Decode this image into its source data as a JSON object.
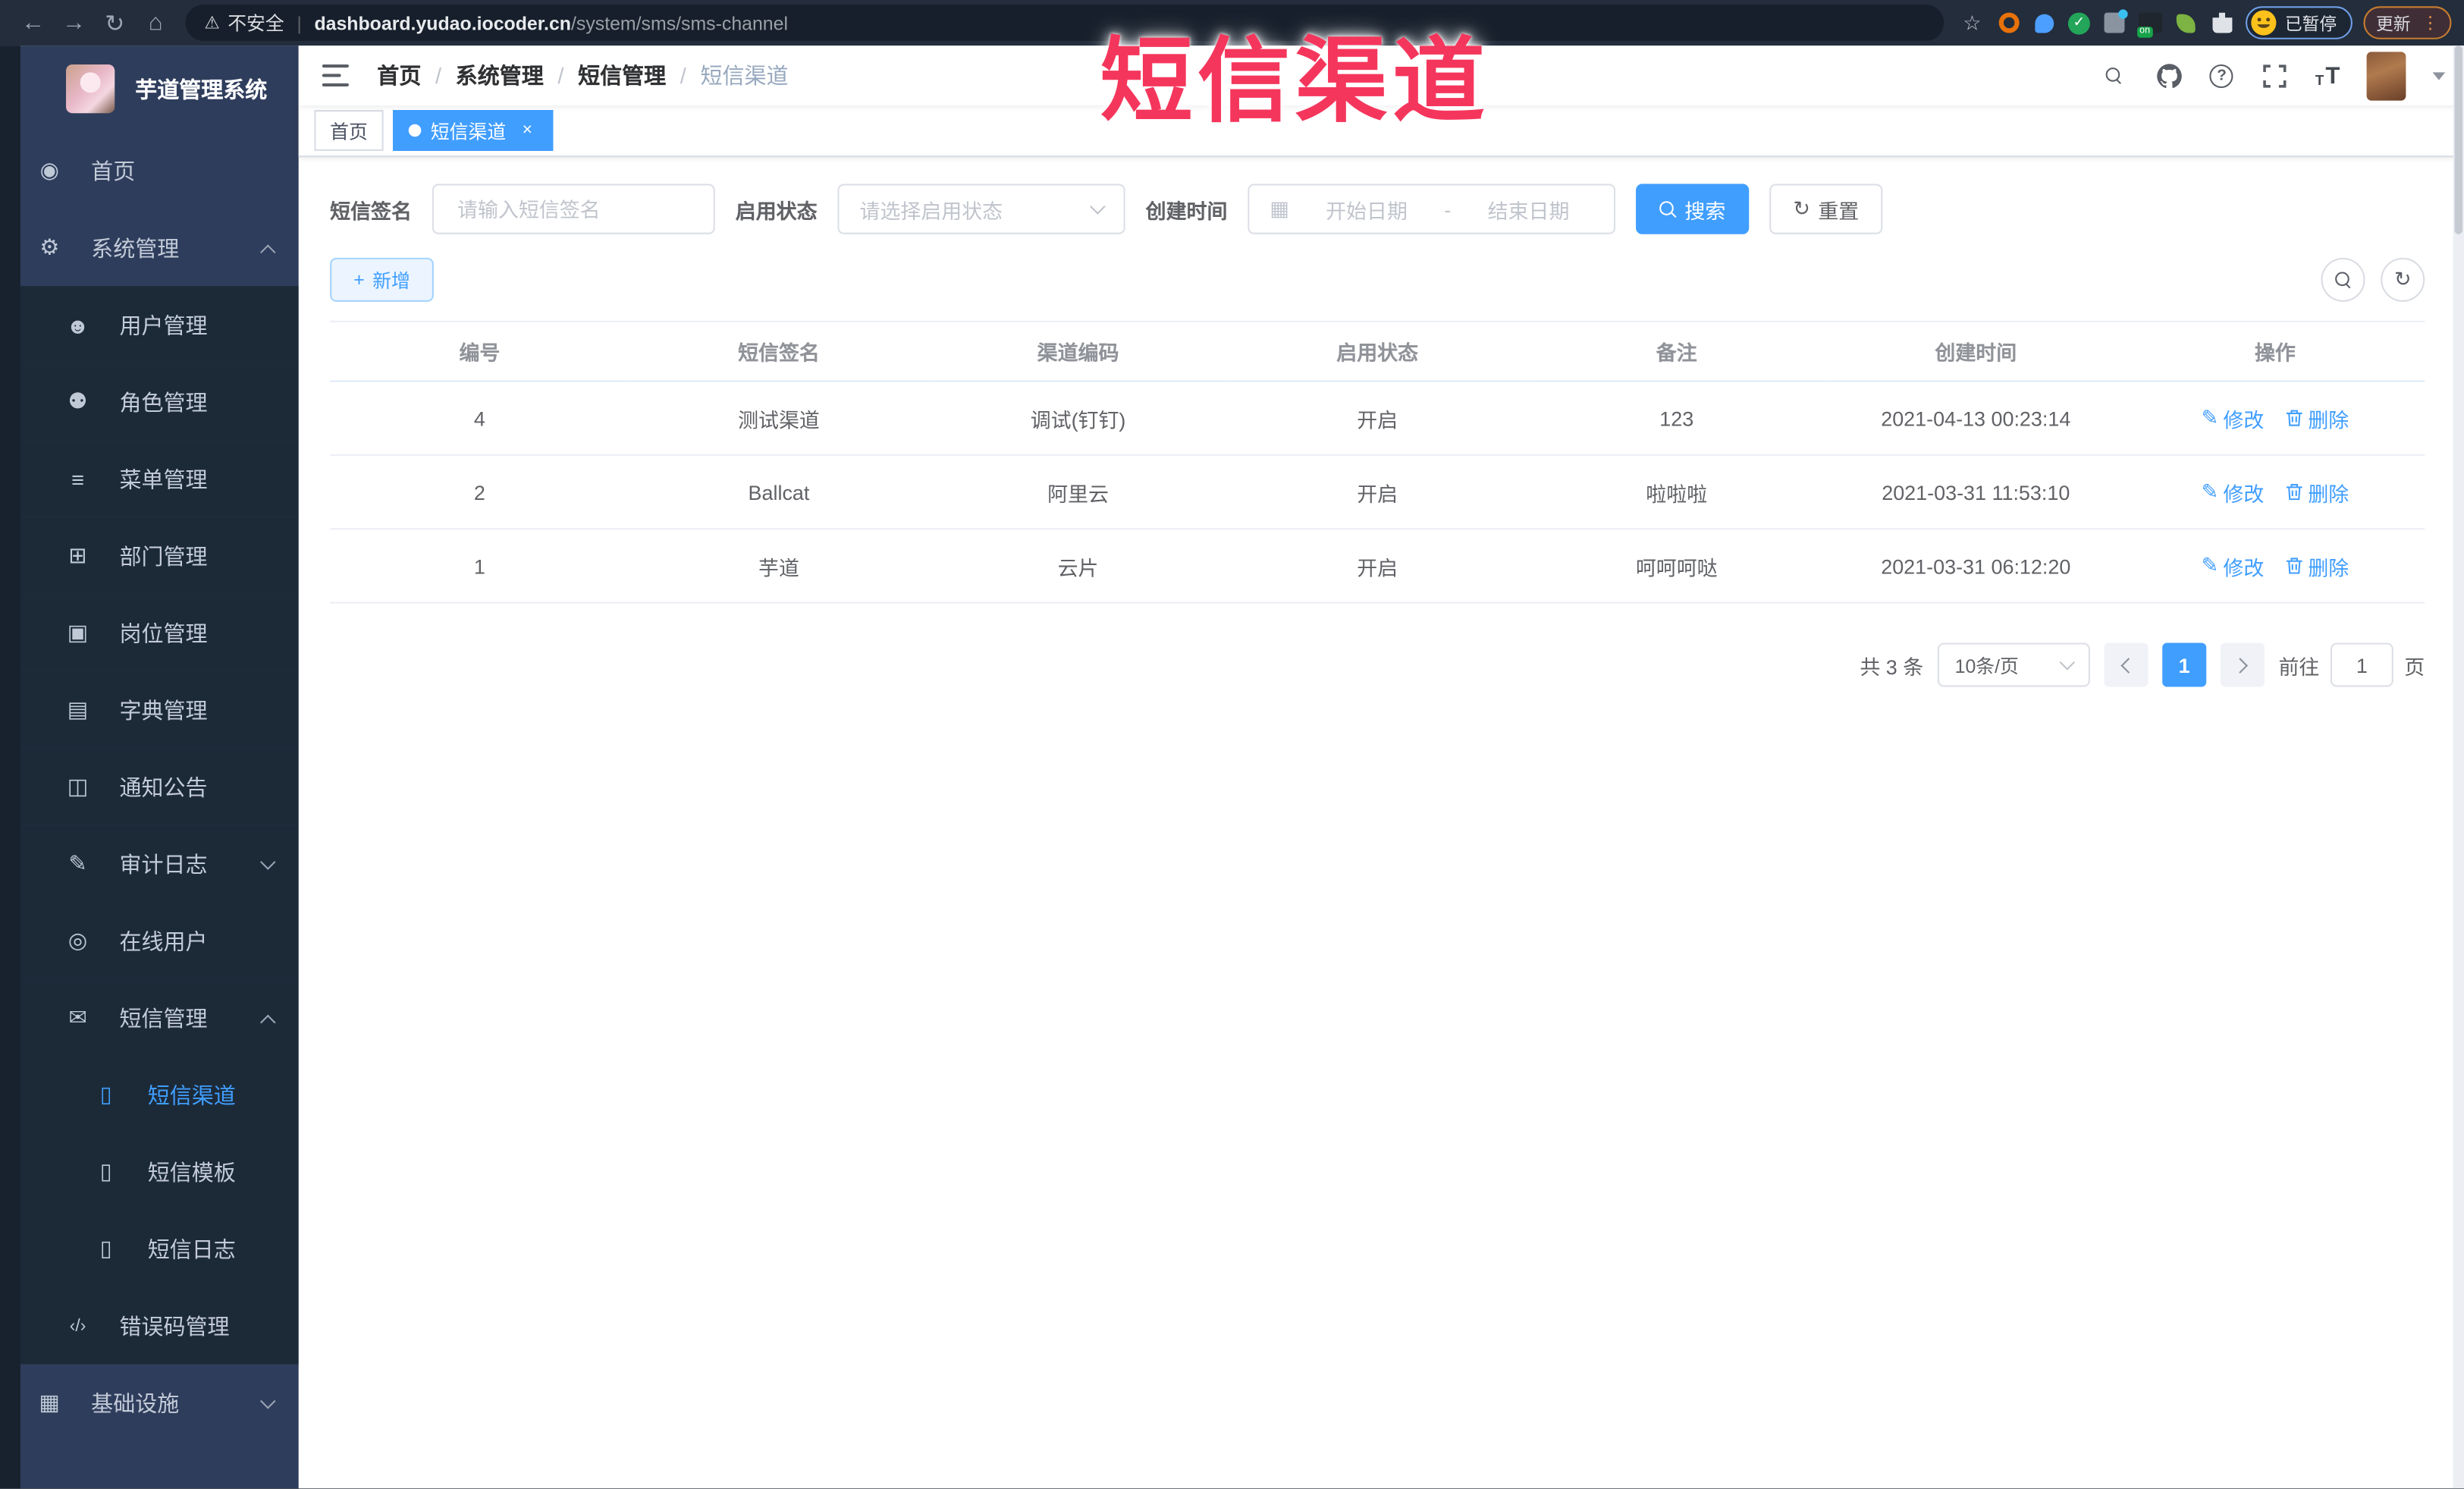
{
  "annotation": {
    "text": "短信渠道"
  },
  "browser": {
    "nav": {
      "back": "←",
      "forward": "→",
      "reload": "↻",
      "home": "⌂"
    },
    "warning_icon": "⚠",
    "security_label": "不安全",
    "separator": "|",
    "url_host": "dashboard.yudao.iocoder.cn",
    "url_path": "/system/sms/sms-channel",
    "star_icon": "☆",
    "extensions": {
      "check_glyph": "✓",
      "on_badge": "on"
    },
    "paused_badge": "已暂停",
    "update_button": "更新",
    "menu_dots": "⋮"
  },
  "sidebar": {
    "title": "芋道管理系统",
    "items": [
      {
        "label": "首页",
        "icon": "◉"
      },
      {
        "label": "系统管理",
        "icon": "⚙"
      },
      {
        "label": "用户管理",
        "icon": "☻"
      },
      {
        "label": "角色管理",
        "icon": "⚉"
      },
      {
        "label": "菜单管理",
        "icon": "≡"
      },
      {
        "label": "部门管理",
        "icon": "⊞"
      },
      {
        "label": "岗位管理",
        "icon": "▣"
      },
      {
        "label": "字典管理",
        "icon": "▤"
      },
      {
        "label": "通知公告",
        "icon": "◫"
      },
      {
        "label": "审计日志",
        "icon": "✎"
      },
      {
        "label": "在线用户",
        "icon": "◎"
      },
      {
        "label": "短信管理",
        "icon": "✉"
      },
      {
        "label": "短信渠道",
        "icon": "▯"
      },
      {
        "label": "短信模板",
        "icon": "▯"
      },
      {
        "label": "短信日志",
        "icon": "▯"
      },
      {
        "label": "错误码管理",
        "icon": "‹/›"
      },
      {
        "label": "基础设施",
        "icon": "▦"
      }
    ]
  },
  "navbar": {
    "breadcrumb": {
      "separator": "/",
      "items": [
        "首页",
        "系统管理",
        "短信管理",
        "短信渠道"
      ]
    },
    "question_glyph": "?",
    "font_size_glyph": "T"
  },
  "tabs": [
    {
      "label": "首页"
    },
    {
      "label": "短信渠道",
      "close": "×"
    }
  ],
  "filters": {
    "sign_label": "短信签名",
    "sign_placeholder": "请输入短信签名",
    "status_label": "启用状态",
    "status_placeholder": "请选择启用状态",
    "time_label": "创建时间",
    "calendar_glyph": "▦",
    "start_placeholder": "开始日期",
    "range_separator": "-",
    "end_placeholder": "结束日期",
    "search_label": "搜索",
    "reset_icon": "↻",
    "reset_label": "重置"
  },
  "toolbar": {
    "add_icon": "+",
    "add_label": "新增",
    "refresh_icon": "↻"
  },
  "table": {
    "headers": [
      "编号",
      "短信签名",
      "渠道编码",
      "启用状态",
      "备注",
      "创建时间",
      "操作"
    ],
    "edit_icon": "✎",
    "edit_label": "修改",
    "delete_label": "删除",
    "rows": [
      {
        "id": "4",
        "sign": "测试渠道",
        "code": "调试(钉钉)",
        "status": "开启",
        "remark": "123",
        "created": "2021-04-13 00:23:14"
      },
      {
        "id": "2",
        "sign": "Ballcat",
        "code": "阿里云",
        "status": "开启",
        "remark": "啦啦啦",
        "created": "2021-03-31 11:53:10"
      },
      {
        "id": "1",
        "sign": "芋道",
        "code": "云片",
        "status": "开启",
        "remark": "呵呵呵哒",
        "created": "2021-03-31 06:12:20"
      }
    ]
  },
  "pagination": {
    "total_text": "共 3 条",
    "page_size": "10条/页",
    "current_page": "1",
    "goto_label": "前往",
    "goto_value": "1",
    "page_label": "页"
  },
  "colors": {
    "primary": "#409eff",
    "annotation": "#f5365c",
    "sidebar_dark": "#1c2a38",
    "sidebar_light": "#2f3d5c"
  }
}
